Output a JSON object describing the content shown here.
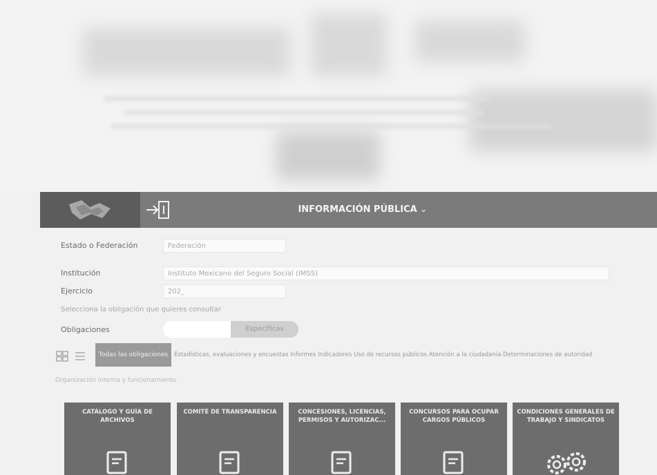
{
  "navbar": {
    "menu_title": "INFORMACIÓN PÚBLICA",
    "menu_chevron": "⌄",
    "logo_icon": "logo-emblem",
    "login_icon": "login-arrow-icon"
  },
  "form": {
    "estado_label": "Estado o Federación",
    "estado_value": "Federación",
    "institucion_label": "Institución",
    "institucion_value": "Instituto Mexicano del Seguro Social (IMSS)",
    "ejercicio_label": "Ejercicio",
    "ejercicio_value": "202_",
    "instruction": "Selecciona la obligación que quieres consultar",
    "obligaciones_label": "Obligaciones",
    "toggle_option_a": "",
    "toggle_option_b": "Específicas"
  },
  "filters": {
    "active_chip": "Todas las obligaciones",
    "other_chips": "Estadísticas, evaluaciones y encuestas   Informes   Indicadores   Uso de recursos públicos   Atención a la ciudadanía   Determinaciones de autoridad"
  },
  "org_link": "Organización interna y funcionamiento",
  "tiles": [
    {
      "label": "CATÁLOGO Y GUÍA DE ARCHIVOS",
      "icon": "document-icon"
    },
    {
      "label": "COMITÉ DE TRANSPARENCIA",
      "icon": "document-icon"
    },
    {
      "label": "CONCESIONES, LICENCIAS, PERMISOS Y AUTORIZAC...",
      "icon": "document-icon"
    },
    {
      "label": "CONCURSOS PARA OCUPAR CARGOS PÚBLICOS",
      "icon": "document-icon"
    },
    {
      "label": "CONDICIONES GENERALES DE TRABAJO Y SINDICATOS",
      "icon": "gears-icon"
    }
  ]
}
